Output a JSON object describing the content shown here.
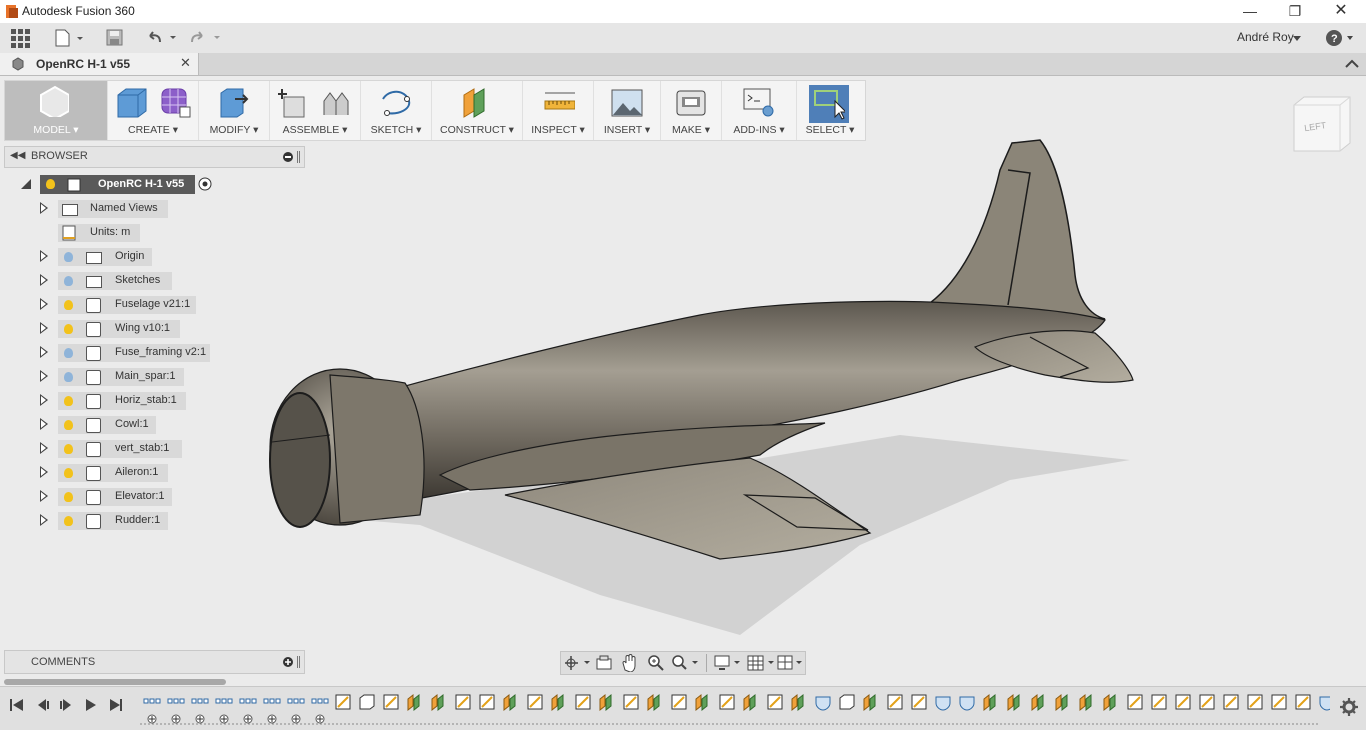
{
  "window": {
    "title": "Autodesk Fusion 360"
  },
  "user": {
    "name": "André Roy"
  },
  "document": {
    "tab_title": "OpenRC H-1 v55"
  },
  "toolbar": {
    "model": "MODEL",
    "create": "CREATE",
    "modify": "MODIFY",
    "assemble": "ASSEMBLE",
    "sketch": "SKETCH",
    "construct": "CONSTRUCT",
    "inspect": "INSPECT",
    "insert": "INSERT",
    "make": "MAKE",
    "addins": "ADD-INS",
    "select": "SELECT"
  },
  "browser": {
    "title": "BROWSER",
    "root": "OpenRC H-1 v55",
    "items": [
      {
        "label": "Named Views",
        "icon": "folder-icon",
        "visible": null
      },
      {
        "label": "Units: m",
        "icon": "document-icon",
        "visible": null
      },
      {
        "label": "Origin",
        "icon": "folder-icon",
        "visible": false
      },
      {
        "label": "Sketches",
        "icon": "folder-icon",
        "visible": false
      },
      {
        "label": "Fuselage v21:1",
        "icon": "component-icon",
        "visible": true
      },
      {
        "label": "Wing v10:1",
        "icon": "component-icon",
        "visible": true
      },
      {
        "label": "Fuse_framing v2:1",
        "icon": "component-icon",
        "visible": false
      },
      {
        "label": "Main_spar:1",
        "icon": "component-icon",
        "visible": false
      },
      {
        "label": "Horiz_stab:1",
        "icon": "component-icon",
        "visible": true
      },
      {
        "label": "Cowl:1",
        "icon": "component-icon",
        "visible": true
      },
      {
        "label": "vert_stab:1",
        "icon": "component-icon",
        "visible": true
      },
      {
        "label": "Aileron:1",
        "icon": "component-icon",
        "visible": true
      },
      {
        "label": "Elevator:1",
        "icon": "component-icon",
        "visible": true
      },
      {
        "label": "Rudder:1",
        "icon": "component-icon",
        "visible": true
      }
    ]
  },
  "comments": {
    "title": "COMMENTS"
  },
  "viewcube": {
    "face": "LEFT"
  },
  "colors": {
    "accent": "#4f7fb8",
    "bulb_on": "#f2c21b",
    "bulb_off": "#8fb4d9"
  }
}
